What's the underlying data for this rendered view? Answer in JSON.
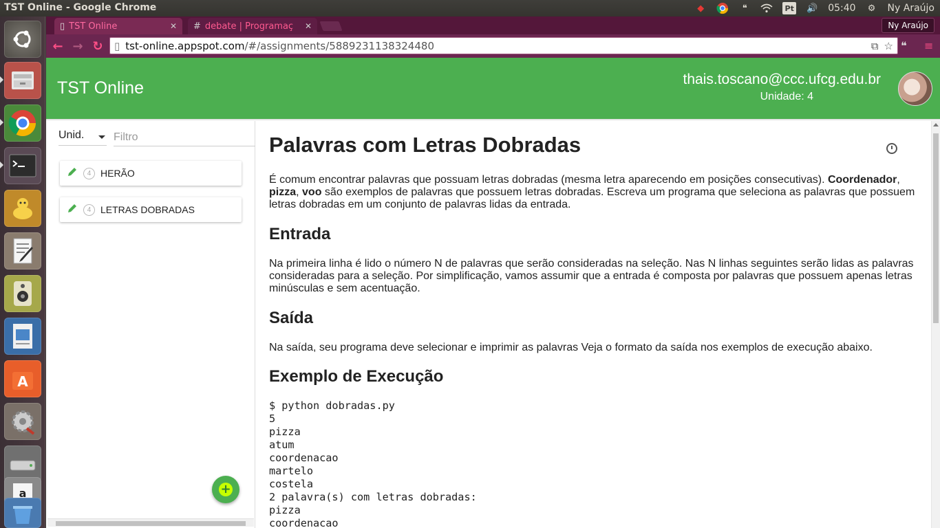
{
  "os": {
    "window_title": "TST Online - Google Chrome",
    "keyboard_layout": "Pt",
    "clock": "05:40",
    "user": "Ny Araújo"
  },
  "browser": {
    "tabs": [
      {
        "label": "TST Online"
      },
      {
        "label": "debate | Programaç"
      }
    ],
    "profile_name": "Ny Araújo",
    "url_host": "tst-online.appspot.com",
    "url_path": "/#/assignments/5889231138324480"
  },
  "app": {
    "title": "TST Online",
    "user_email": "thais.toscano@ccc.ufcg.edu.br",
    "unit_label": "Unidade: 4",
    "colors": {
      "primary": "#4caf50",
      "accent": "#c6ff00"
    }
  },
  "sidebar": {
    "unit_select": "Unid.",
    "filter_placeholder": "Filtro",
    "assignments": [
      {
        "unit": "4",
        "title": "HERÃO"
      },
      {
        "unit": "4",
        "title": "LETRAS DOBRADAS"
      }
    ]
  },
  "content": {
    "title": "Palavras com Letras Dobradas",
    "intro_1": "É comum encontrar palavras que possuam letras dobradas (mesma letra aparecendo em posições consecutivas). ",
    "intro_b1": "Coordenador",
    "intro_sep1": ", ",
    "intro_b2": "pizza",
    "intro_sep2": ", ",
    "intro_b3": "voo",
    "intro_2": " são exemplos de palavras que possuem letras dobradas. Escreva um programa que seleciona as palavras que possuem letras dobradas em um conjunto de palavras lidas da entrada.",
    "input_heading": "Entrada",
    "input_text": "Na primeira linha é lido o número N de palavras que serão consideradas na seleção. Nas N linhas seguintes serão lidas as palavras consideradas para a seleção. Por simplificação, vamos assumir que a entrada é composta por palavras que possuem apenas letras minúsculas e sem acentuação.",
    "output_heading": "Saída",
    "output_text": "Na saída, seu programa deve selecionar e imprimir as palavras Veja o formato da saída nos exemplos de execução abaixo.",
    "example_heading": "Exemplo de Execução",
    "example_code": "$ python dobradas.py\n5\npizza\natum\ncoordenacao\nmartelo\ncostela\n2 palavra(s) com letras dobradas:\npizza\ncoordenacao"
  }
}
